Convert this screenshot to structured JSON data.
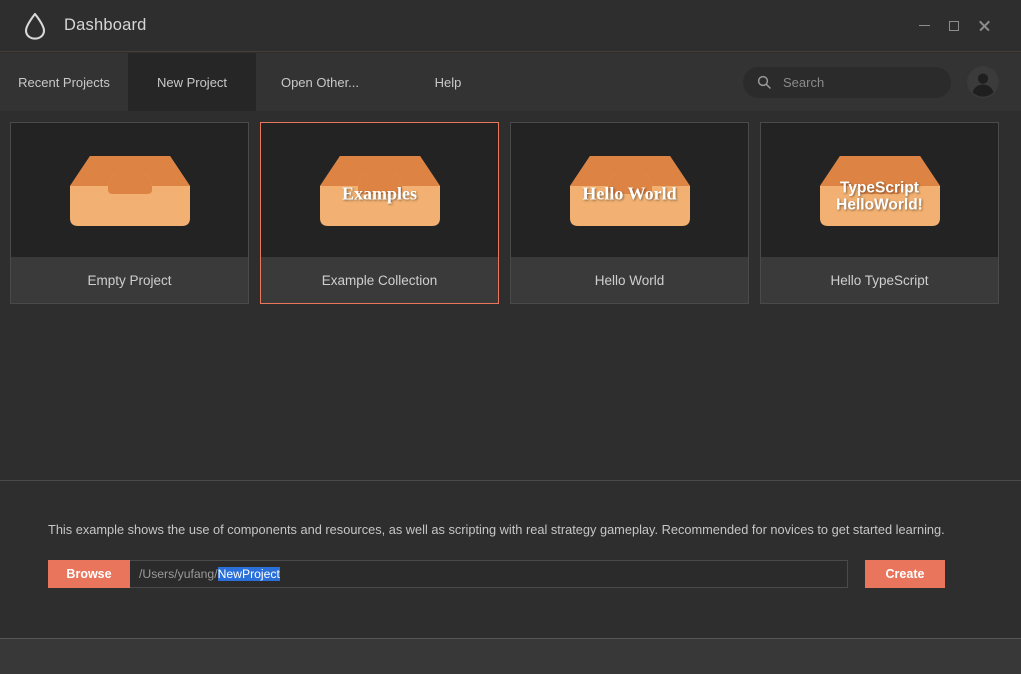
{
  "window": {
    "title": "Dashboard",
    "logo_icon": "droplet-icon",
    "minimize_label": "Minimize",
    "maximize_label": "Maximize",
    "close_label": "Close"
  },
  "tabs": [
    {
      "label": "Recent Projects",
      "active": false
    },
    {
      "label": "New Project",
      "active": true
    },
    {
      "label": "Open Other...",
      "active": false
    },
    {
      "label": "Help",
      "active": false
    }
  ],
  "search": {
    "placeholder": "Search",
    "value": "",
    "icon": "search-icon"
  },
  "account": {
    "avatar_icon": "user-avatar-icon"
  },
  "cards": [
    {
      "label": "Empty Project",
      "thumb_text": "",
      "thumb_text_style": "serif",
      "selected": false,
      "icon": "project-box-icon"
    },
    {
      "label": "Example Collection",
      "thumb_text": "Examples",
      "thumb_text_style": "serif",
      "selected": true,
      "icon": "project-box-icon"
    },
    {
      "label": "Hello World",
      "thumb_text": "Hello World",
      "thumb_text_style": "serif",
      "selected": false,
      "icon": "project-box-icon"
    },
    {
      "label": "Hello TypeScript",
      "thumb_text": "TypeScript\nHelloWorld!",
      "thumb_text_style": "sans",
      "selected": false,
      "icon": "project-box-icon"
    }
  ],
  "description": "This example shows the use of components and resources, as well as scripting with real strategy gameplay. Recommended for novices to get started learning.",
  "form": {
    "browse_label": "Browse",
    "path_prefix": "/Users/yufang/",
    "path_selected": "NewProject",
    "create_label": "Create"
  },
  "colors": {
    "accent": "#e8755c",
    "selection_blue": "#2a70d8",
    "box_light": "#f2b172",
    "box_dark": "#dd8444",
    "window_bg": "#2e2e2e",
    "tabbar_bg": "#333333",
    "active_tab_bg": "#262626",
    "thumb_bg": "#232323",
    "card_label_bg": "#3a3a3a"
  }
}
